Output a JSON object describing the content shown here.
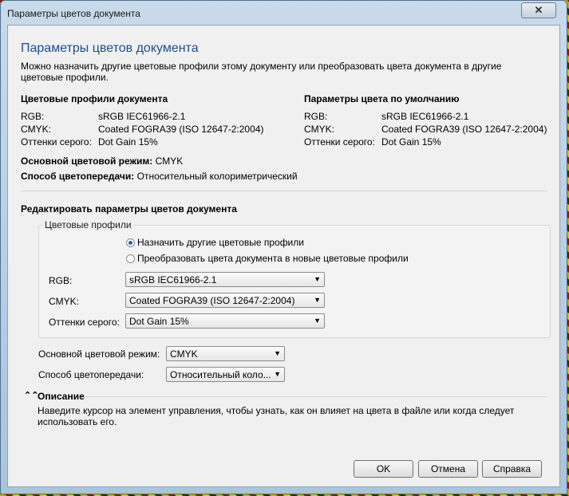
{
  "window": {
    "title": "Параметры цветов документа",
    "close": "✕"
  },
  "header": {
    "title": "Параметры цветов документа",
    "description": "Можно назначить другие цветовые профили этому документу или преобразовать цвета документа в другие цветовые профили."
  },
  "doc_profiles": {
    "title": "Цветовые профили документа",
    "rgb_label": "RGB:",
    "rgb_value": "sRGB IEC61966-2.1",
    "cmyk_label": "CMYK:",
    "cmyk_value": "Coated FOGRA39 (ISO 12647-2:2004)",
    "gray_label": "Оттенки серого:",
    "gray_value": "Dot Gain 15%"
  },
  "defaults": {
    "title": "Параметры цвета по умолчанию",
    "rgb_label": "RGB:",
    "rgb_value": "sRGB IEC61966-2.1",
    "cmyk_label": "CMYK:",
    "cmyk_value": "Coated FOGRA39 (ISO 12647-2:2004)",
    "gray_label": "Оттенки серого:",
    "gray_value": "Dot Gain 15%"
  },
  "primary_mode": {
    "label": "Основной цветовой режим:",
    "value": "CMYK"
  },
  "rendering": {
    "label": "Способ цветопередачи:",
    "value": "Относительный колориметрический"
  },
  "edit": {
    "title": "Редактировать параметры цветов документа",
    "group_label": "Цветовые профили",
    "radio_assign": "Назначить другие цветовые профили",
    "radio_convert": "Преобразовать цвета документа в новые цветовые профили",
    "rgb_label": "RGB:",
    "rgb_select": "sRGB IEC61966-2.1",
    "cmyk_label": "CMYK:",
    "cmyk_select": "Coated FOGRA39 (ISO 12647-2:2004)",
    "gray_label": "Оттенки серого:",
    "gray_select": "Dot Gain 15%",
    "mode_label": "Основной цветовой режим:",
    "mode_select": "CMYK",
    "intent_label": "Способ цветопередачи:",
    "intent_select": "Относительный коло..."
  },
  "description": {
    "title": "Описание",
    "text": "Наведите курсор на элемент управления, чтобы узнать, как он влияет на цвета в файле или когда следует использовать его."
  },
  "buttons": {
    "ok": "OK",
    "cancel": "Отмена",
    "help": "Справка"
  },
  "icons": {
    "close": "close-icon",
    "dropdown": "chevron-down-icon",
    "collapse": "double-chevron-up-icon"
  }
}
